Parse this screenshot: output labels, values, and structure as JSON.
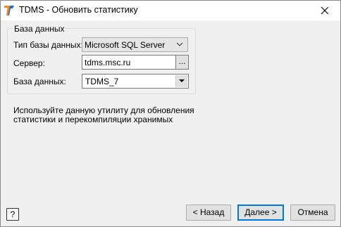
{
  "window": {
    "title": "TDMS - Обновить статистику",
    "icon": "tdms-app-icon"
  },
  "database_group": {
    "legend": "База данных",
    "db_type_label": "Тип базы данных:",
    "db_type_value": "Microsoft SQL Server",
    "server_label": "Сервер:",
    "server_value": "tdms.msc.ru",
    "browse_label": "...",
    "database_label": "База данных:",
    "database_value": "TDMS_7"
  },
  "description": "Используйте данную утилиту для обновления статистики и перекомпиляции хранимых",
  "buttons": {
    "help": "?",
    "back": "< Назад",
    "next": "Далее >",
    "cancel": "Отмена"
  },
  "colors": {
    "accent": "#0078d7",
    "logo_orange": "#f28c1e",
    "logo_blue": "#1f6fd0"
  }
}
